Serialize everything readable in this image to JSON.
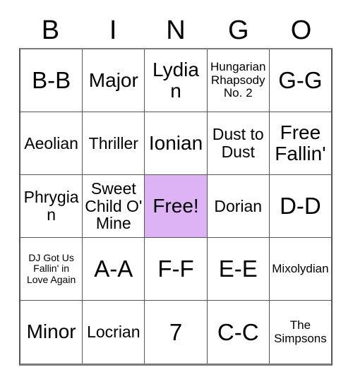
{
  "card": {
    "header": {
      "letters": [
        "B",
        "I",
        "N",
        "G",
        "O"
      ]
    },
    "rows": [
      {
        "cells": [
          {
            "text": "B-B",
            "size": "xl",
            "free": false
          },
          {
            "text": "Major",
            "size": "lg",
            "free": false
          },
          {
            "text": "Lydian",
            "size": "lg",
            "free": false
          },
          {
            "text": "Hungarian Rhapsody No. 2",
            "size": "sm",
            "free": false
          },
          {
            "text": "G-G",
            "size": "xl",
            "free": false
          }
        ]
      },
      {
        "cells": [
          {
            "text": "Aeolian",
            "size": "md",
            "free": false
          },
          {
            "text": "Thriller",
            "size": "md",
            "free": false
          },
          {
            "text": "Ionian",
            "size": "lg",
            "free": false
          },
          {
            "text": "Dust to Dust",
            "size": "md",
            "free": false
          },
          {
            "text": "Free Fallin'",
            "size": "lg",
            "free": false
          }
        ]
      },
      {
        "cells": [
          {
            "text": "Phrygian",
            "size": "md",
            "free": false
          },
          {
            "text": "Sweet Child O' Mine",
            "size": "md",
            "free": false
          },
          {
            "text": "Free!",
            "size": "lg",
            "free": true
          },
          {
            "text": "Dorian",
            "size": "md",
            "free": false
          },
          {
            "text": "D-D",
            "size": "xl",
            "free": false
          }
        ]
      },
      {
        "cells": [
          {
            "text": "DJ Got Us Fallin' in Love Again",
            "size": "xs",
            "free": false
          },
          {
            "text": "A-A",
            "size": "xl",
            "free": false
          },
          {
            "text": "F-F",
            "size": "xl",
            "free": false
          },
          {
            "text": "E-E",
            "size": "xl",
            "free": false
          },
          {
            "text": "Mixolydian",
            "size": "sm",
            "free": false
          }
        ]
      },
      {
        "cells": [
          {
            "text": "Minor",
            "size": "lg",
            "free": false
          },
          {
            "text": "Locrian",
            "size": "md",
            "free": false
          },
          {
            "text": "7",
            "size": "xl",
            "free": false
          },
          {
            "text": "C-C",
            "size": "xl",
            "free": false
          },
          {
            "text": "The Simpsons",
            "size": "sm",
            "free": false
          }
        ]
      }
    ],
    "colors": {
      "free_cell_background": "#ddb3f5",
      "grid_line": "#555555",
      "outer_border": "#7a7a7a",
      "text": "#000000",
      "page_background": "#ffffff"
    }
  }
}
